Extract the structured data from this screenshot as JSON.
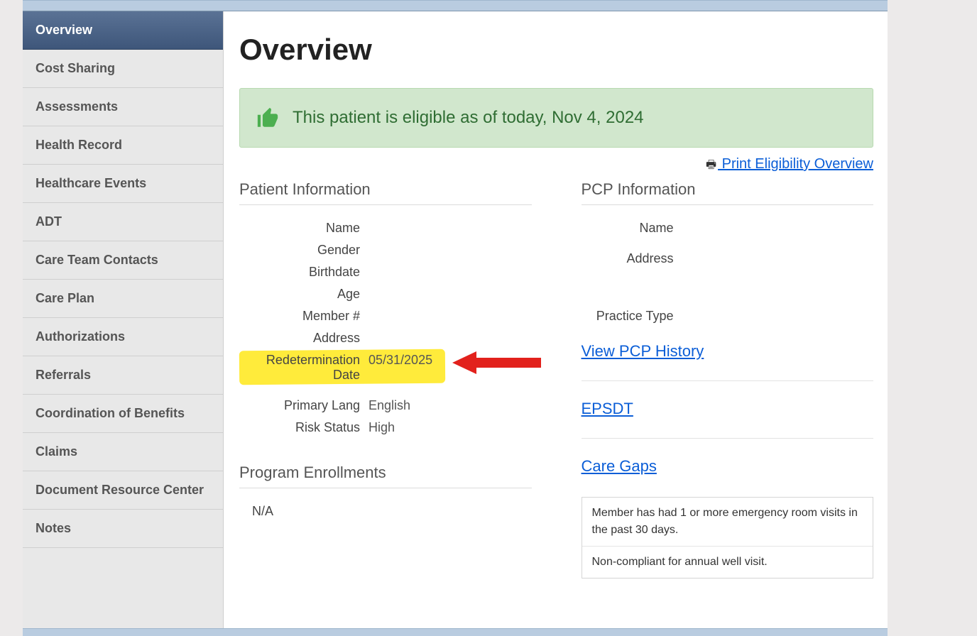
{
  "sidebar": {
    "items": [
      {
        "label": "Overview",
        "active": true
      },
      {
        "label": "Cost Sharing"
      },
      {
        "label": "Assessments"
      },
      {
        "label": "Health Record"
      },
      {
        "label": "Healthcare Events"
      },
      {
        "label": "ADT"
      },
      {
        "label": "Care Team Contacts"
      },
      {
        "label": "Care Plan"
      },
      {
        "label": "Authorizations"
      },
      {
        "label": "Referrals"
      },
      {
        "label": "Coordination of Benefits"
      },
      {
        "label": "Claims"
      },
      {
        "label": "Document Resource Center"
      },
      {
        "label": "Notes"
      }
    ]
  },
  "page_title": "Overview",
  "eligibility_banner": "This patient is eligible as of today, Nov 4, 2024",
  "print_link": " Print Eligibility Overview",
  "patient_info": {
    "heading": "Patient Information",
    "labels": {
      "name": "Name",
      "gender": "Gender",
      "birthdate": "Birthdate",
      "age": "Age",
      "member_no": "Member #",
      "address": "Address",
      "redetermination_date": "Redetermination Date",
      "primary_lang": "Primary Lang",
      "risk_status": "Risk Status"
    },
    "values": {
      "name": "",
      "gender": "",
      "birthdate": "",
      "age": "",
      "member_no": "",
      "address": "",
      "redetermination_date": "05/31/2025",
      "primary_lang": "English",
      "risk_status": "High"
    }
  },
  "pcp_info": {
    "heading": "PCP Information",
    "labels": {
      "name": "Name",
      "address": "Address",
      "practice_type": "Practice Type"
    },
    "values": {
      "name": "",
      "address": "",
      "practice_type": ""
    },
    "links": {
      "history": "View PCP History",
      "epsdt": "EPSDT",
      "care_gaps": "Care Gaps"
    }
  },
  "program_enrollments": {
    "heading": "Program Enrollments",
    "value": "N/A"
  },
  "care_gap_messages": [
    "Member has had 1 or more emergency room visits in the past 30 days.",
    "Non-compliant for annual well visit."
  ],
  "colors": {
    "link": "#0b5ed7",
    "success_bg": "#d1e7cd",
    "success_text": "#2f6d33",
    "highlight": "#ffeb3b",
    "arrow": "#e2211c",
    "risk": "#c27512"
  }
}
